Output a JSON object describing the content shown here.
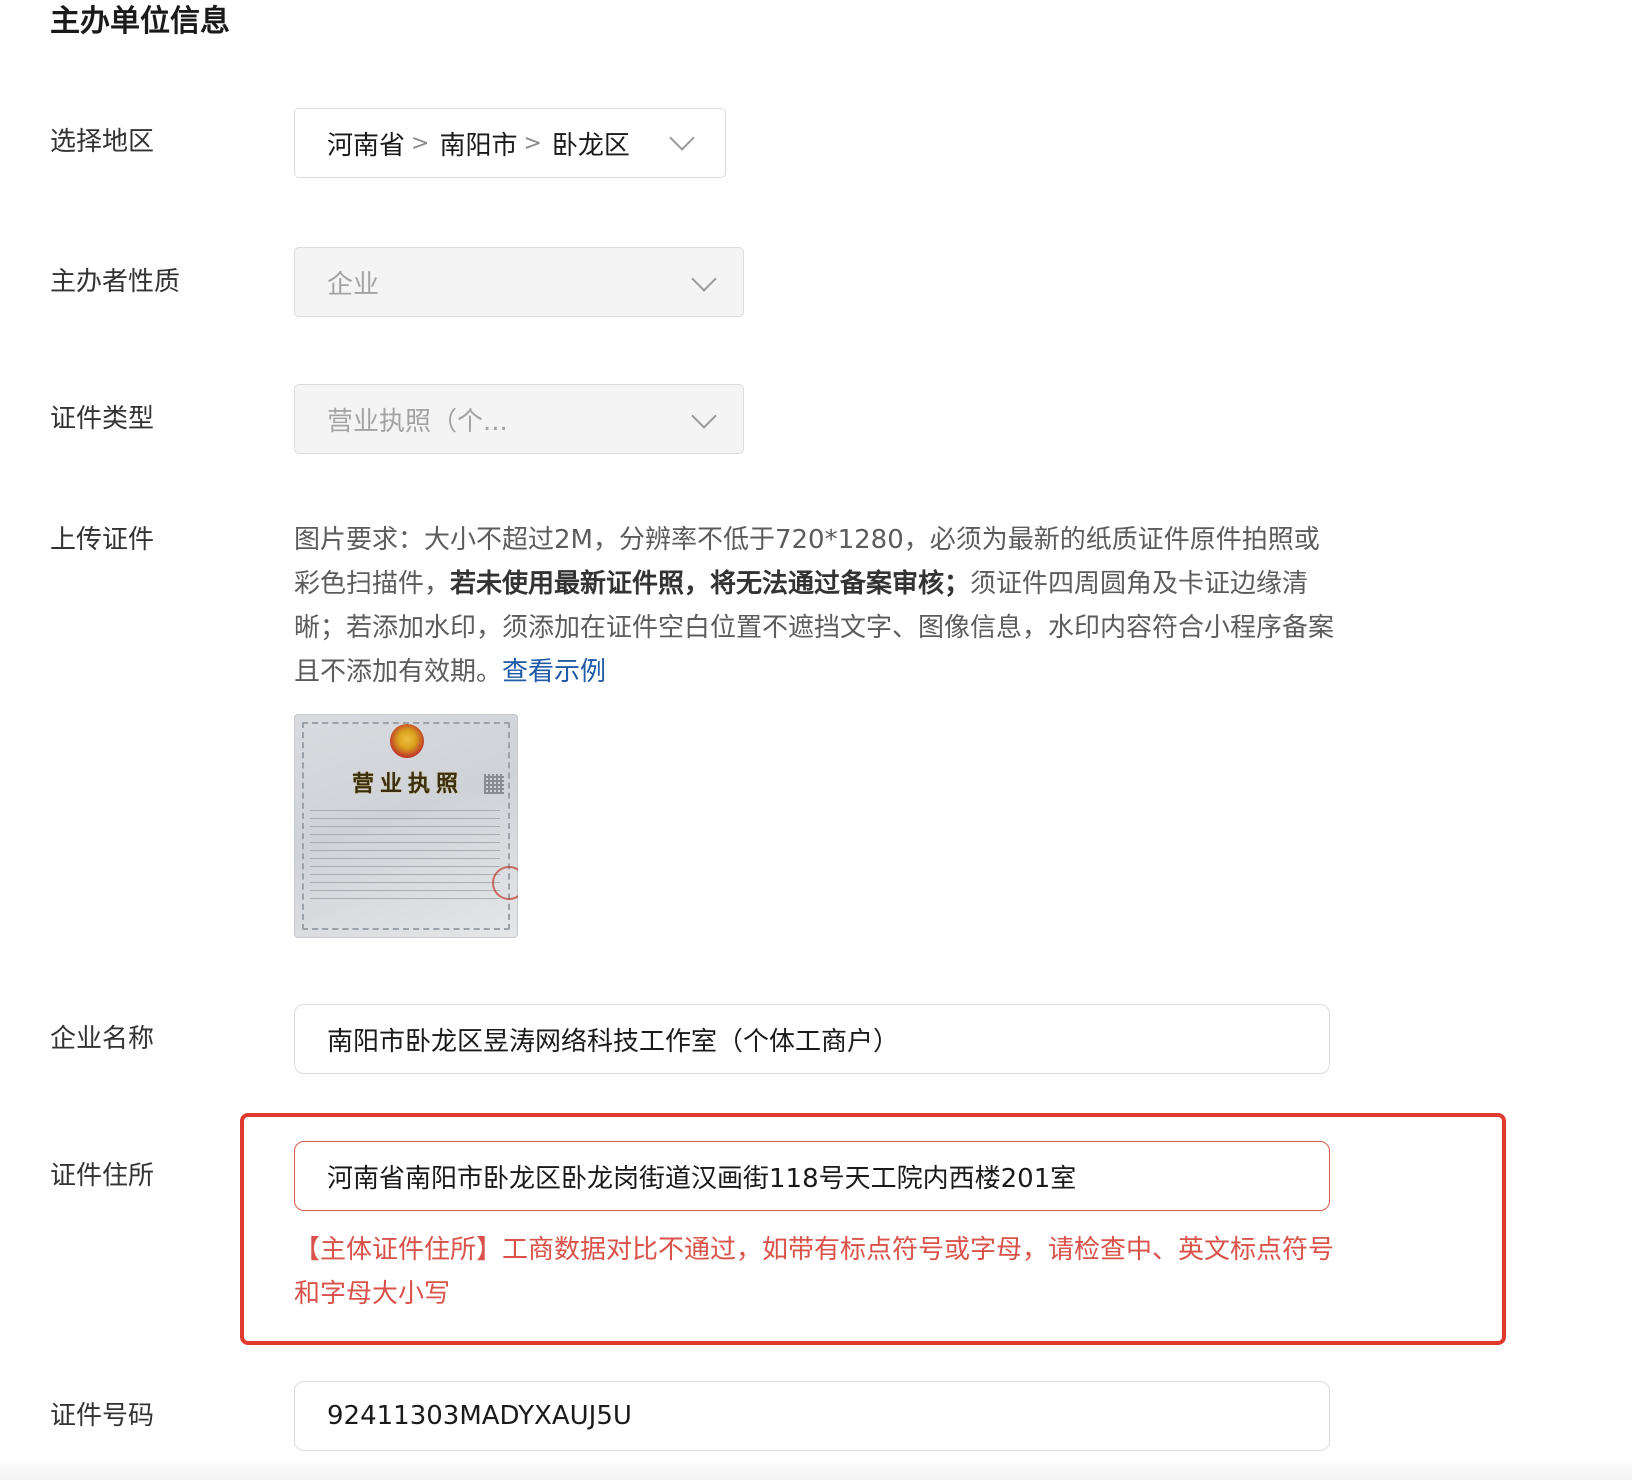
{
  "section_title": "主办单位信息",
  "region": {
    "label": "选择地区",
    "province": "河南省",
    "city": "南阳市",
    "district": "卧龙区",
    "separator": ">"
  },
  "organizer_type": {
    "label": "主办者性质",
    "value": "企业"
  },
  "certificate_type": {
    "label": "证件类型",
    "value": "营业执照（个..."
  },
  "upload": {
    "label": "上传证件",
    "desc_part1": "图片要求：大小不超过2M，分辨率不低于720*1280，必须为最新的纸质证件原件拍照或彩色扫描件，",
    "desc_strong": "若未使用最新证件照，将无法通过备案审核；",
    "desc_part2": "须证件四周圆角及卡证边缘清晰；若添加水印，须添加在证件空白位置不遮挡文字、图像信息，水印内容符合小程序备案且不添加有效期。",
    "example_link": "查看示例",
    "thumbnail_title": "营业执照"
  },
  "company_name": {
    "label": "企业名称",
    "value": "南阳市卧龙区昱涛网络科技工作室（个体工商户）"
  },
  "certificate_address": {
    "label": "证件住所",
    "value": "河南省南阳市卧龙区卧龙岗街道汉画街118号天工院内西楼201室",
    "error": "【主体证件住所】工商数据对比不通过，如带有标点符号或字母，请检查中、英文标点符号和字母大小写"
  },
  "certificate_number": {
    "label": "证件号码",
    "value": "92411303MADYXAUJ5U"
  },
  "colors": {
    "error_red": "#d9534a",
    "highlight_red": "#e0392d",
    "link_blue": "#1f5aa6",
    "disabled_bg": "#f4f4f4"
  }
}
